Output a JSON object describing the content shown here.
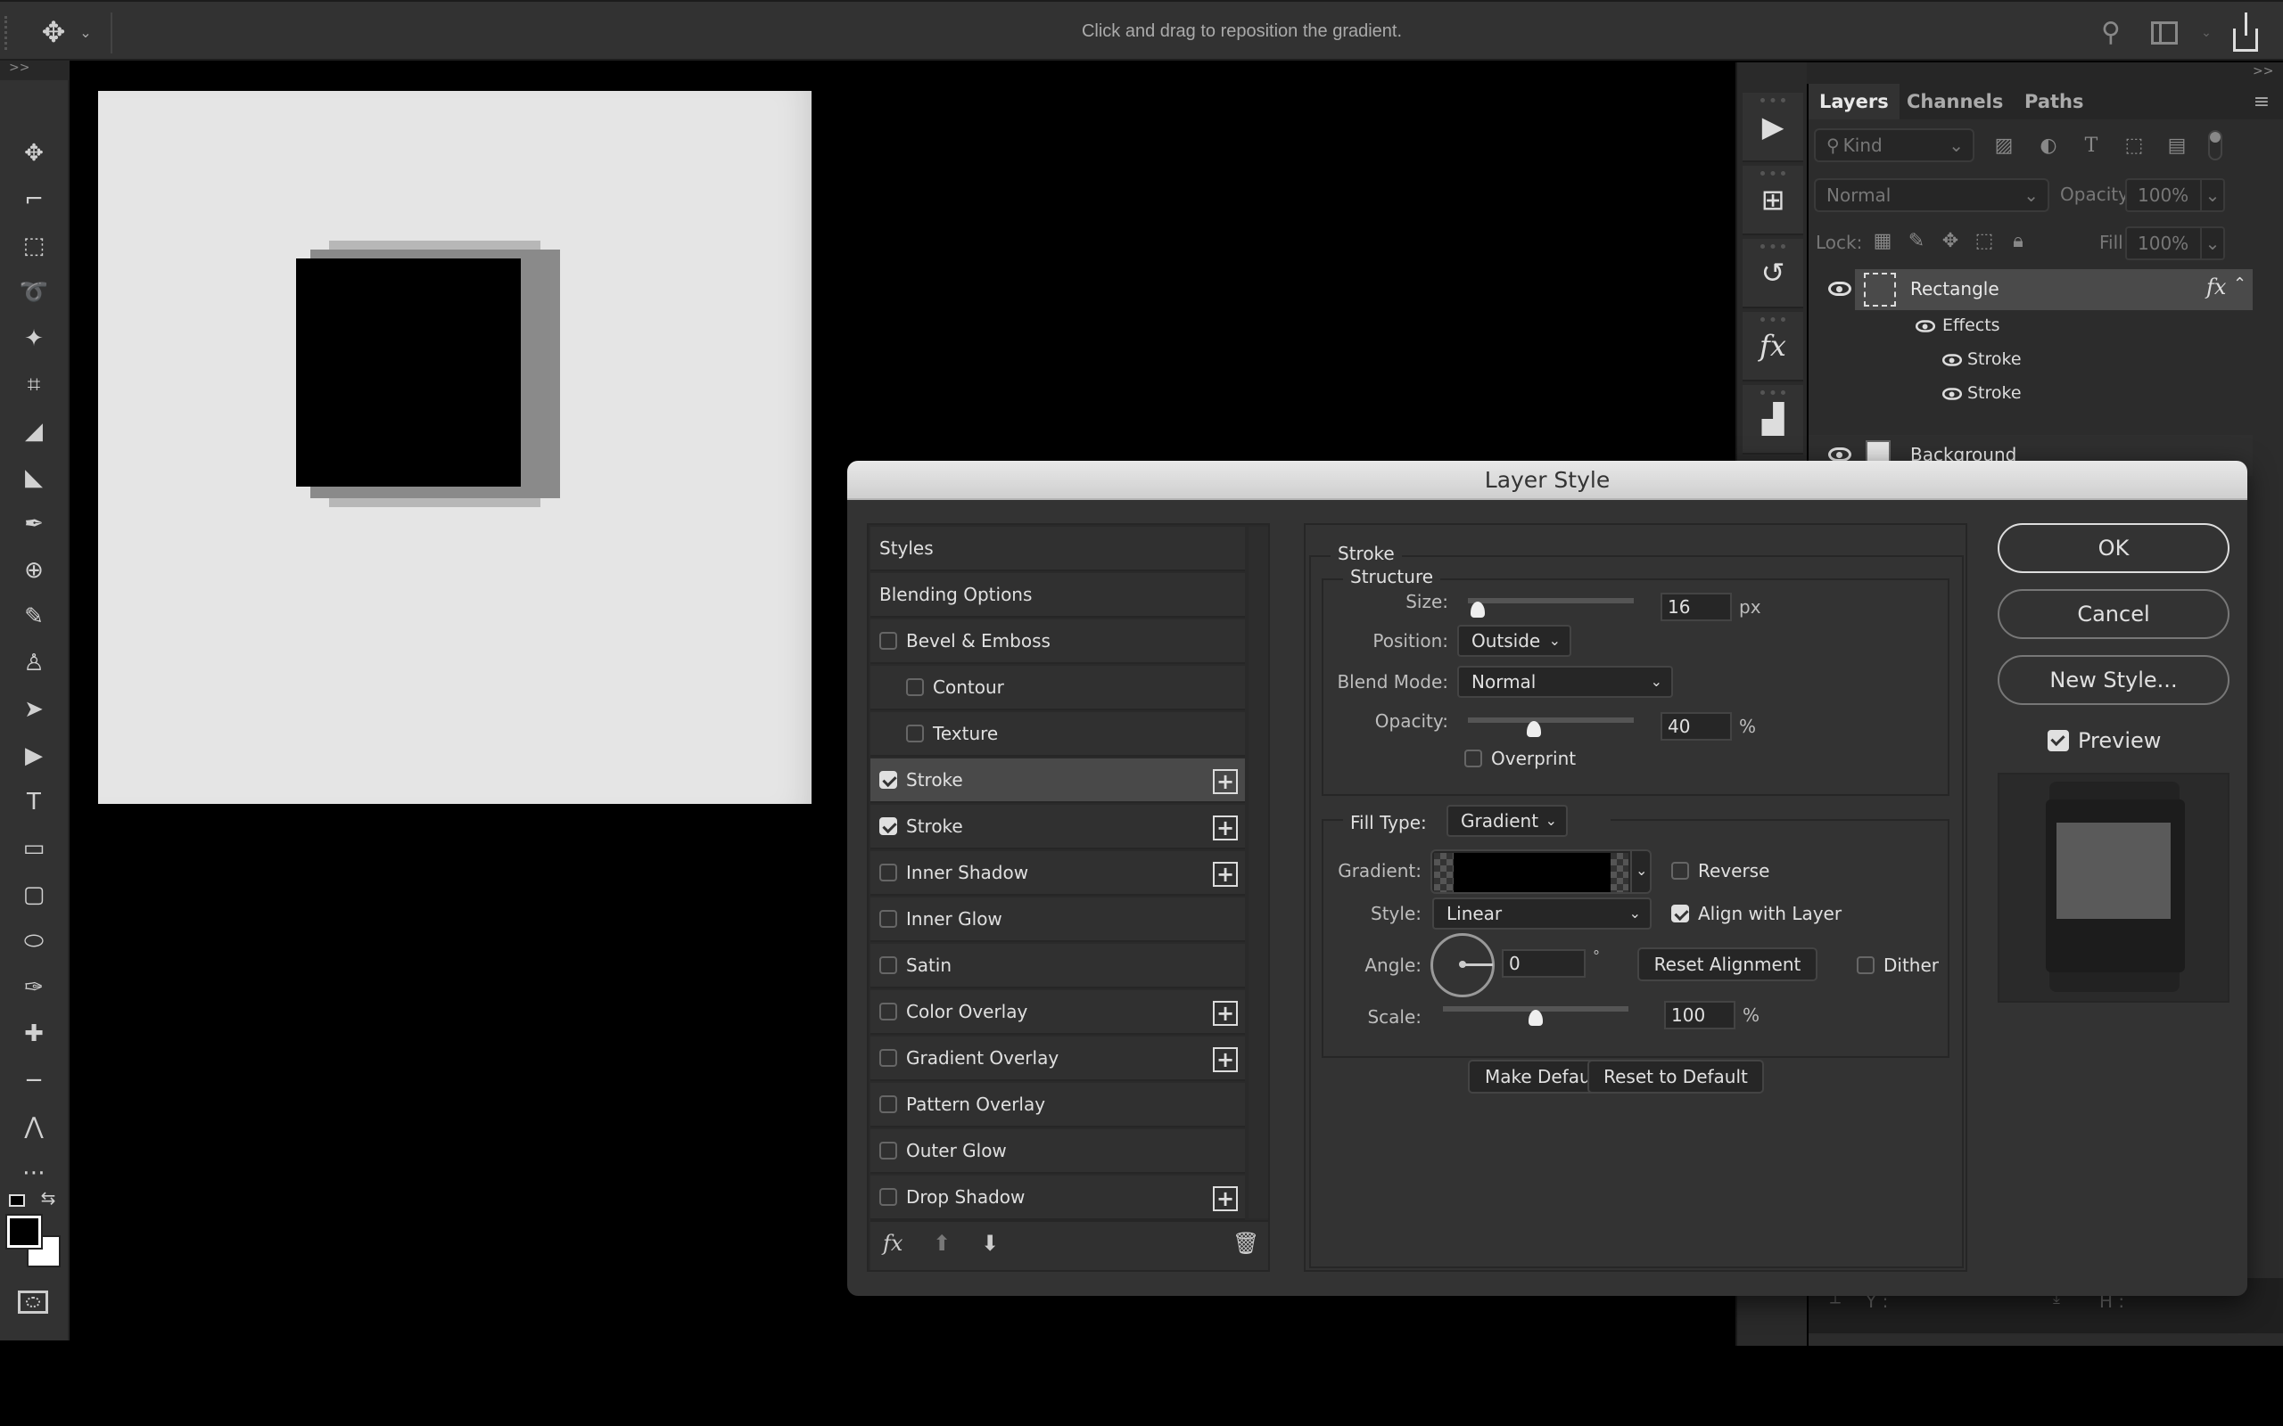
{
  "topbar": {
    "hint": "Click and drag to reposition the gradient.",
    "tool_icon": "move-icon",
    "right_icons": [
      "search-icon",
      "workspace-icon",
      "share-icon"
    ]
  },
  "toolbar": {
    "collapse": ">>",
    "tools": [
      "move-icon",
      "artboard-icon",
      "marquee-icon",
      "magnetic-lasso-icon",
      "magic-wand-icon",
      "crop-icon",
      "slice-icon",
      "slice-select-icon",
      "eyedropper-icon",
      "color-sampler-icon",
      "brush-icon",
      "stamp-icon",
      "path-select-icon",
      "direct-select-icon",
      "type-icon",
      "rectangle-icon",
      "rounded-rectangle-icon",
      "ellipse-icon",
      "pen-icon",
      "add-anchor-icon",
      "delete-anchor-icon",
      "convert-point-icon",
      "more-icon"
    ],
    "foreground_color": "#000000",
    "background_color": "#ffffff"
  },
  "document": {
    "background_color": "#e5e5e5",
    "shape_color": "#000000",
    "stroke_inner_color": "#8a8a8a",
    "stroke_outer_color": "#b7b7b7"
  },
  "dock": {
    "collapse_left": "<<",
    "collapse_right": ">>",
    "buttons": [
      "play-icon",
      "timeline-icon",
      "history-icon",
      "styles-fx-icon",
      "histogram-icon"
    ]
  },
  "layers_panel": {
    "tabs": [
      "Layers",
      "Channels",
      "Paths"
    ],
    "active_tab": "Layers",
    "filter": {
      "label": "Kind"
    },
    "blend_mode": "Normal",
    "opacity_label": "Opacity:",
    "opacity_value": "100%",
    "lock_label": "Lock:",
    "fill_label": "Fill:",
    "fill_value": "100%",
    "layers": [
      {
        "name": "Rectangle",
        "fx": "fx",
        "effects_label": "Effects",
        "effects": [
          "Stroke",
          "Stroke"
        ]
      },
      {
        "name": "Background"
      }
    ],
    "info": {
      "y_label": "Y :",
      "h_label": "H :"
    }
  },
  "dialog": {
    "title": "Layer Style",
    "styles": [
      {
        "label": "Styles",
        "checkbox": null,
        "plus": false
      },
      {
        "label": "Blending Options",
        "checkbox": null,
        "plus": false
      },
      {
        "label": "Bevel & Emboss",
        "checkbox": false,
        "plus": false
      },
      {
        "label": "Contour",
        "checkbox": false,
        "plus": false,
        "indent": true
      },
      {
        "label": "Texture",
        "checkbox": false,
        "plus": false,
        "indent": true
      },
      {
        "label": "Stroke",
        "checkbox": true,
        "plus": true,
        "selected": true
      },
      {
        "label": "Stroke",
        "checkbox": true,
        "plus": true
      },
      {
        "label": "Inner Shadow",
        "checkbox": false,
        "plus": true
      },
      {
        "label": "Inner Glow",
        "checkbox": false,
        "plus": false
      },
      {
        "label": "Satin",
        "checkbox": false,
        "plus": false
      },
      {
        "label": "Color Overlay",
        "checkbox": false,
        "plus": true
      },
      {
        "label": "Gradient Overlay",
        "checkbox": false,
        "plus": true
      },
      {
        "label": "Pattern Overlay",
        "checkbox": false,
        "plus": false
      },
      {
        "label": "Outer Glow",
        "checkbox": false,
        "plus": false
      },
      {
        "label": "Drop Shadow",
        "checkbox": false,
        "plus": true
      }
    ],
    "footer": {
      "fx": "fx"
    },
    "stroke": {
      "section": "Stroke",
      "structure": "Structure",
      "size_label": "Size:",
      "size": "16",
      "size_unit": "px",
      "size_slider_fraction": 0.06,
      "position_label": "Position:",
      "position": "Outside",
      "blend_label": "Blend Mode:",
      "blend": "Normal",
      "opacity_label": "Opacity:",
      "opacity": "40",
      "opacity_unit": "%",
      "opacity_slider_fraction": 0.4,
      "overprint_label": "Overprint",
      "overprint": false,
      "fill_type_label": "Fill Type:",
      "fill_type": "Gradient",
      "gradient_label": "Gradient:",
      "reverse_label": "Reverse",
      "reverse": false,
      "style_label": "Style:",
      "style": "Linear",
      "align_label": "Align with Layer",
      "align": true,
      "angle_label": "Angle:",
      "angle": "0",
      "angle_unit": "°",
      "reset_alignment": "Reset Alignment",
      "dither_label": "Dither",
      "dither": false,
      "scale_label": "Scale:",
      "scale": "100",
      "scale_unit": "%",
      "scale_slider_fraction": 0.5,
      "make_default": "Make Default",
      "reset_default": "Reset to Default"
    },
    "buttons": {
      "ok": "OK",
      "cancel": "Cancel",
      "new_style": "New Style..."
    },
    "preview_label": "Preview",
    "preview": true
  }
}
